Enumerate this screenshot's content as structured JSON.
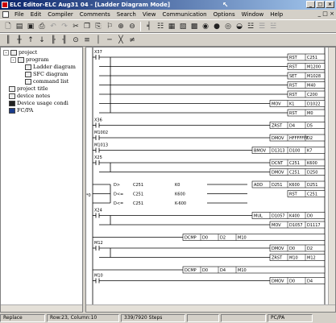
{
  "window": {
    "title": "ELC Editor-ELC Aug31 04 - [Ladder Diagram Mode]"
  },
  "menu": [
    "File",
    "Edit",
    "Compiler",
    "Comments",
    "Search",
    "View",
    "Communication",
    "Options",
    "Window",
    "Help"
  ],
  "mdi_buttons": "_ □ ×",
  "toolbar1_icons": [
    "new-icon",
    "open-icon",
    "save-icon",
    "print-icon",
    "undo-icon",
    "redo-icon",
    "cut-icon",
    "copy-icon",
    "paste-icon",
    "find-icon",
    "zoom-in-icon",
    "zoom-out-icon",
    "ladder-mode-icon",
    "sfc-mode-icon",
    "compile-icon",
    "online-icon",
    "monitor-icon",
    "run-icon",
    "stop-icon",
    "device-icon",
    "read-icon",
    "write-icon",
    "comment-icon",
    "help-icon"
  ],
  "toolbar2_icons": [
    "contact-no-icon",
    "contact-nc-icon",
    "rising-contact-icon",
    "falling-contact-icon",
    "parallel-no-icon",
    "parallel-nc-icon",
    "coil-icon",
    "function-icon",
    "vline-icon",
    "hline-icon",
    "delete-line-icon",
    "invert-icon"
  ],
  "tree": {
    "root": "project",
    "program": "program",
    "ladder": "Ladder diagram",
    "sfc": "SFC diagram",
    "command_list": "command list",
    "project_title": "project title",
    "device_notes": "device notes",
    "device_usage": "Device usage condi",
    "fcpa": "FC/PA"
  },
  "ladder": {
    "left_marker": "*0",
    "rungs": [
      {
        "contact": "X37",
        "outputs": [
          [
            "RST",
            "C251"
          ],
          [
            "RST",
            "M1200"
          ],
          [
            "SET",
            "M1028"
          ],
          [
            "RST",
            "M40"
          ],
          [
            "RST",
            "C200"
          ],
          [
            "MOV",
            "K1",
            "D1022"
          ],
          [
            "RST",
            "M0"
          ]
        ]
      },
      {
        "contact": "X36",
        "outputs": [
          [
            "ZRST",
            "D4",
            "D5"
          ]
        ]
      },
      {
        "contact": "M1002",
        "outputs": [
          [
            "DMOV",
            "HFFFFFFF",
            "D2"
          ]
        ]
      },
      {
        "contact": "M1013",
        "outputs": [
          [
            "BMOV",
            "D1313",
            "D100",
            "K7"
          ]
        ]
      },
      {
        "contact": "X25",
        "outputs": [
          [
            "DCNT",
            "C251",
            "K600"
          ],
          [
            "DMOV",
            "C251",
            "D250"
          ]
        ]
      },
      {
        "compares": [
          [
            "D>",
            "C251",
            "K0"
          ],
          [
            "D<=",
            "C251",
            "K600"
          ],
          [
            "D<=",
            "C251",
            "K-600"
          ]
        ],
        "outputs": [
          [
            "ADD",
            "D251",
            "K600",
            "D251"
          ],
          [
            "RST",
            "C251"
          ]
        ]
      },
      {
        "contact": "X24",
        "outputs": [
          [
            "MUL",
            "D1057",
            "K400",
            "D0"
          ],
          [
            "MOV",
            "D1057",
            "D1117"
          ]
        ]
      },
      {
        "compare_mid": [
          "DCMP",
          "D0",
          "D2",
          "M10"
        ]
      },
      {
        "contact": "M12",
        "outputs": [
          [
            "DMOV",
            "D0",
            "D2"
          ],
          [
            "ZRST",
            "M10",
            "M12"
          ]
        ]
      },
      {
        "compare_mid": [
          "DCMP",
          "D0",
          "D4",
          "M10"
        ]
      },
      {
        "contact": "M10",
        "outputs": [
          [
            "DMOV",
            "D0",
            "D4"
          ]
        ]
      }
    ]
  },
  "status": {
    "mode": "Replace",
    "position": "Row:23, Column:10",
    "steps": "339/7920 Steps",
    "type": "PC/PA"
  }
}
